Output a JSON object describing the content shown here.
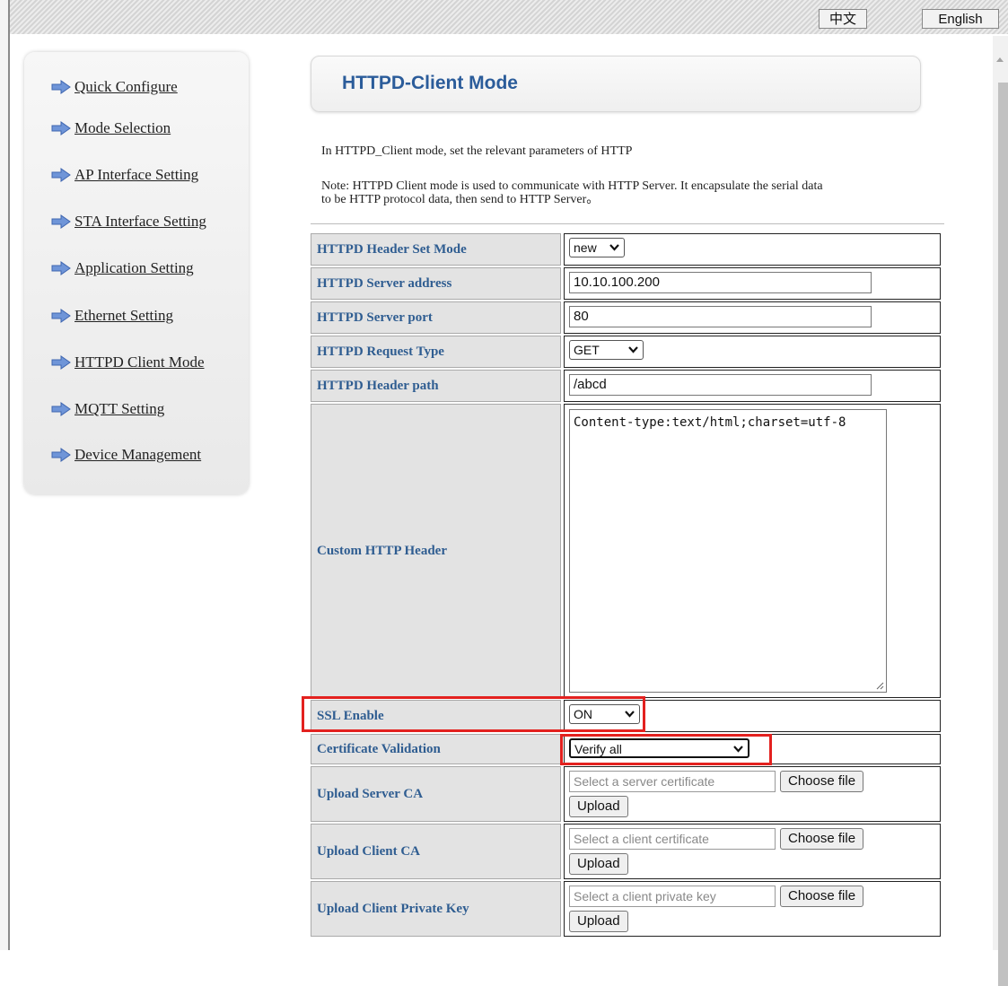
{
  "lang": {
    "zh": "中文",
    "en": "English"
  },
  "sidebar": {
    "items": [
      {
        "label": "Quick Configure"
      },
      {
        "label": "Mode Selection"
      },
      {
        "label": "AP Interface Setting"
      },
      {
        "label": "STA Interface Setting"
      },
      {
        "label": "Application Setting"
      },
      {
        "label": "Ethernet Setting"
      },
      {
        "label": "HTTPD Client Mode"
      },
      {
        "label": "MQTT Setting"
      },
      {
        "label": "Device Management"
      }
    ]
  },
  "page": {
    "title": "HTTPD-Client Mode",
    "intro": "In HTTPD_Client mode, set the relevant parameters of HTTP",
    "note_line1": "Note: HTTPD Client mode is used to communicate with HTTP Server. It encapsulate the serial data",
    "note_line2": "to be HTTP protocol data, then send to HTTP Server。"
  },
  "form": {
    "header_set_mode": {
      "label": "HTTPD Header Set Mode",
      "value": "new"
    },
    "server_address": {
      "label": "HTTPD Server address",
      "value": "10.10.100.200"
    },
    "server_port": {
      "label": "HTTPD Server port",
      "value": "80"
    },
    "request_type": {
      "label": "HTTPD Request Type",
      "value": "GET"
    },
    "header_path": {
      "label": "HTTPD Header path",
      "value": "/abcd"
    },
    "custom_header": {
      "label": "Custom HTTP Header",
      "value": "Content-type:text/html;charset=utf-8"
    },
    "ssl_enable": {
      "label": "SSL Enable",
      "value": "ON"
    },
    "cert_validation": {
      "label": "Certificate Validation",
      "value": "Verify all"
    },
    "server_ca": {
      "label": "Upload Server CA",
      "placeholder": "Select a server certificate",
      "choose": "Choose file",
      "upload": "Upload"
    },
    "client_ca": {
      "label": "Upload Client CA",
      "placeholder": "Select a client certificate",
      "choose": "Choose file",
      "upload": "Upload"
    },
    "client_key": {
      "label": "Upload Client Private Key",
      "placeholder": "Select a client private key",
      "choose": "Choose file",
      "upload": "Upload"
    }
  },
  "colors": {
    "label_text": "#2f5d91",
    "title_text": "#2b5c9a",
    "highlight": "#e3211f"
  }
}
